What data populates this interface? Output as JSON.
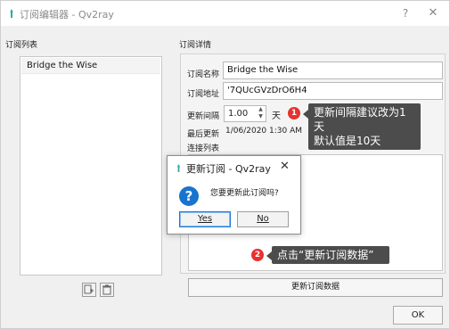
{
  "window": {
    "title": "订阅编辑器 - Qv2ray",
    "help_glyph": "?",
    "close_glyph": "✕"
  },
  "left": {
    "section_label": "订阅列表",
    "items": [
      "Bridge the Wise"
    ]
  },
  "details": {
    "section_label": "订阅详情",
    "name_label": "订阅名称",
    "name_value": "Bridge the Wise",
    "url_label": "订阅地址",
    "url_value": "'7QUcGVzDrO6H4",
    "interval_label": "更新间隔",
    "interval_value": "1.00",
    "interval_unit": "天",
    "last_update_label": "最后更新",
    "last_update_value": "1/06/2020 1:30 AM",
    "connections_label": "连接列表",
    "update_button": "更新订阅数据"
  },
  "footer": {
    "ok_button": "OK"
  },
  "dialog": {
    "title": "更新订阅 - Qv2ray",
    "close_glyph": "✕",
    "question_glyph": "?",
    "message": "您要更新此订阅吗?",
    "yes_button": "Yes",
    "no_button": "No"
  },
  "annotations": {
    "badge1": "1",
    "tip1_line1": "更新间隔建议改为1天",
    "tip1_line2": "默认值是10天",
    "badge2": "2",
    "tip2": "点击“更新订阅数据”"
  },
  "colors": {
    "accent": "#1874cd",
    "badge": "#e8312f",
    "tooltip": "#4c4c4c",
    "app_icon": "#3aa89c"
  },
  "icons": {
    "app": "qv2ray-app-icon",
    "add": "add-subscription-icon",
    "delete": "trash-icon",
    "question": "question-icon"
  }
}
